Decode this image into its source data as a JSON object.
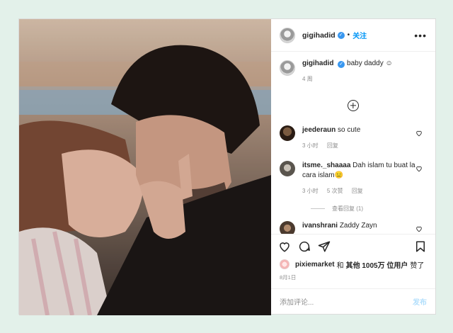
{
  "post": {
    "author": "gigihadid",
    "follow_label": "关注",
    "more_label": "•••",
    "caption_user": "gigihadid",
    "caption_text": "baby daddy ☺",
    "caption_age": "4 周",
    "comments": [
      {
        "user": "jeederaun",
        "text": "so cute",
        "time": "3 小时",
        "reply_label": "回复",
        "likes_count": ""
      },
      {
        "user": "itsme._shaaaa",
        "text": "Dah islam tu buat la cara islam😑",
        "time": "3 小时",
        "likes_count": "5 次赞",
        "reply_label": "回复"
      },
      {
        "user": "ivanshrani",
        "text": "Zaddy Zayn",
        "time": "",
        "reply_label": "",
        "likes_count": ""
      }
    ],
    "view_replies": "查看回复 (1)",
    "liked_by_user": "pixiemarket",
    "likes_and": "和",
    "likes_others": "其他 1005万 位用户",
    "likes_suffix": "赞了",
    "date": "8月1日",
    "add_comment_placeholder": "添加评论...",
    "post_button": "发布"
  },
  "colors": {
    "background": "#e3f1ea",
    "accent": "#0095f6",
    "verified": "#3897f0"
  },
  "icons": [
    "verified-badge-icon",
    "more-options-icon",
    "load-more-plus-icon",
    "heart-icon",
    "comment-icon",
    "share-icon",
    "bookmark-icon"
  ]
}
